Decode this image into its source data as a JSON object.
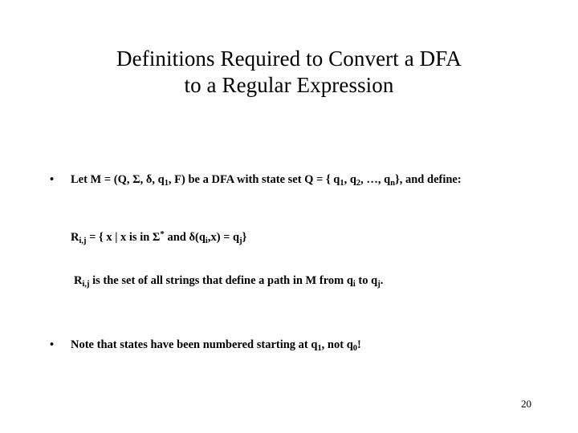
{
  "slide": {
    "page_number": "20",
    "background_color": "#ffffff",
    "text_color": "#000000",
    "title": {
      "full": "Definitions Required to Convert a DFA to a Regular Expression",
      "lines": [
        "Definitions Required to Convert a DFA",
        "to a Regular Expression"
      ]
    },
    "bullets": [
      {
        "marker": "•",
        "text": "Let M = (Q, Σ, δ, q1, F) be a DFA with state set Q = { q1, q2, …, qn}, and define:",
        "parts": {
          "seg1": "Let M = (Q, Σ, δ, q",
          "sub1": "1",
          "seg2": ", F) be a DFA with state set Q = { q",
          "sub2": "1",
          "seg3": ", q",
          "sub3": "2",
          "seg4": ", …, q",
          "sub4": "n",
          "seg5": "}, and define:"
        }
      },
      {
        "marker": "•",
        "text": "Note that states have been numbered starting at q1, not q0!",
        "parts": {
          "seg1": "Note that states have been numbered starting at q",
          "sub1": "1",
          "seg2": ", not q",
          "sub2": "0",
          "seg3": "!"
        }
      }
    ],
    "formulas": [
      {
        "text": "Ri,j = { x | x is in Σ* and δ(qi,x) = qj}",
        "parts": {
          "seg1": "R",
          "sub1": "i,j",
          "seg2": " = { x | x is in Σ",
          "sup1": "*",
          "seg3": " and δ(q",
          "sub2": "i",
          "seg4": ",x) = q",
          "sub3": "j",
          "seg5": "}"
        }
      },
      {
        "text": "Ri,j is the set of all strings that define a path in M from qi to qj.",
        "parts": {
          "seg1": "R",
          "sub1": "i,j",
          "seg2": " is the set of all strings that define a path in M from q",
          "sub2": "i",
          "seg3": " to q",
          "sub3": "j",
          "seg4": "."
        }
      }
    ]
  }
}
